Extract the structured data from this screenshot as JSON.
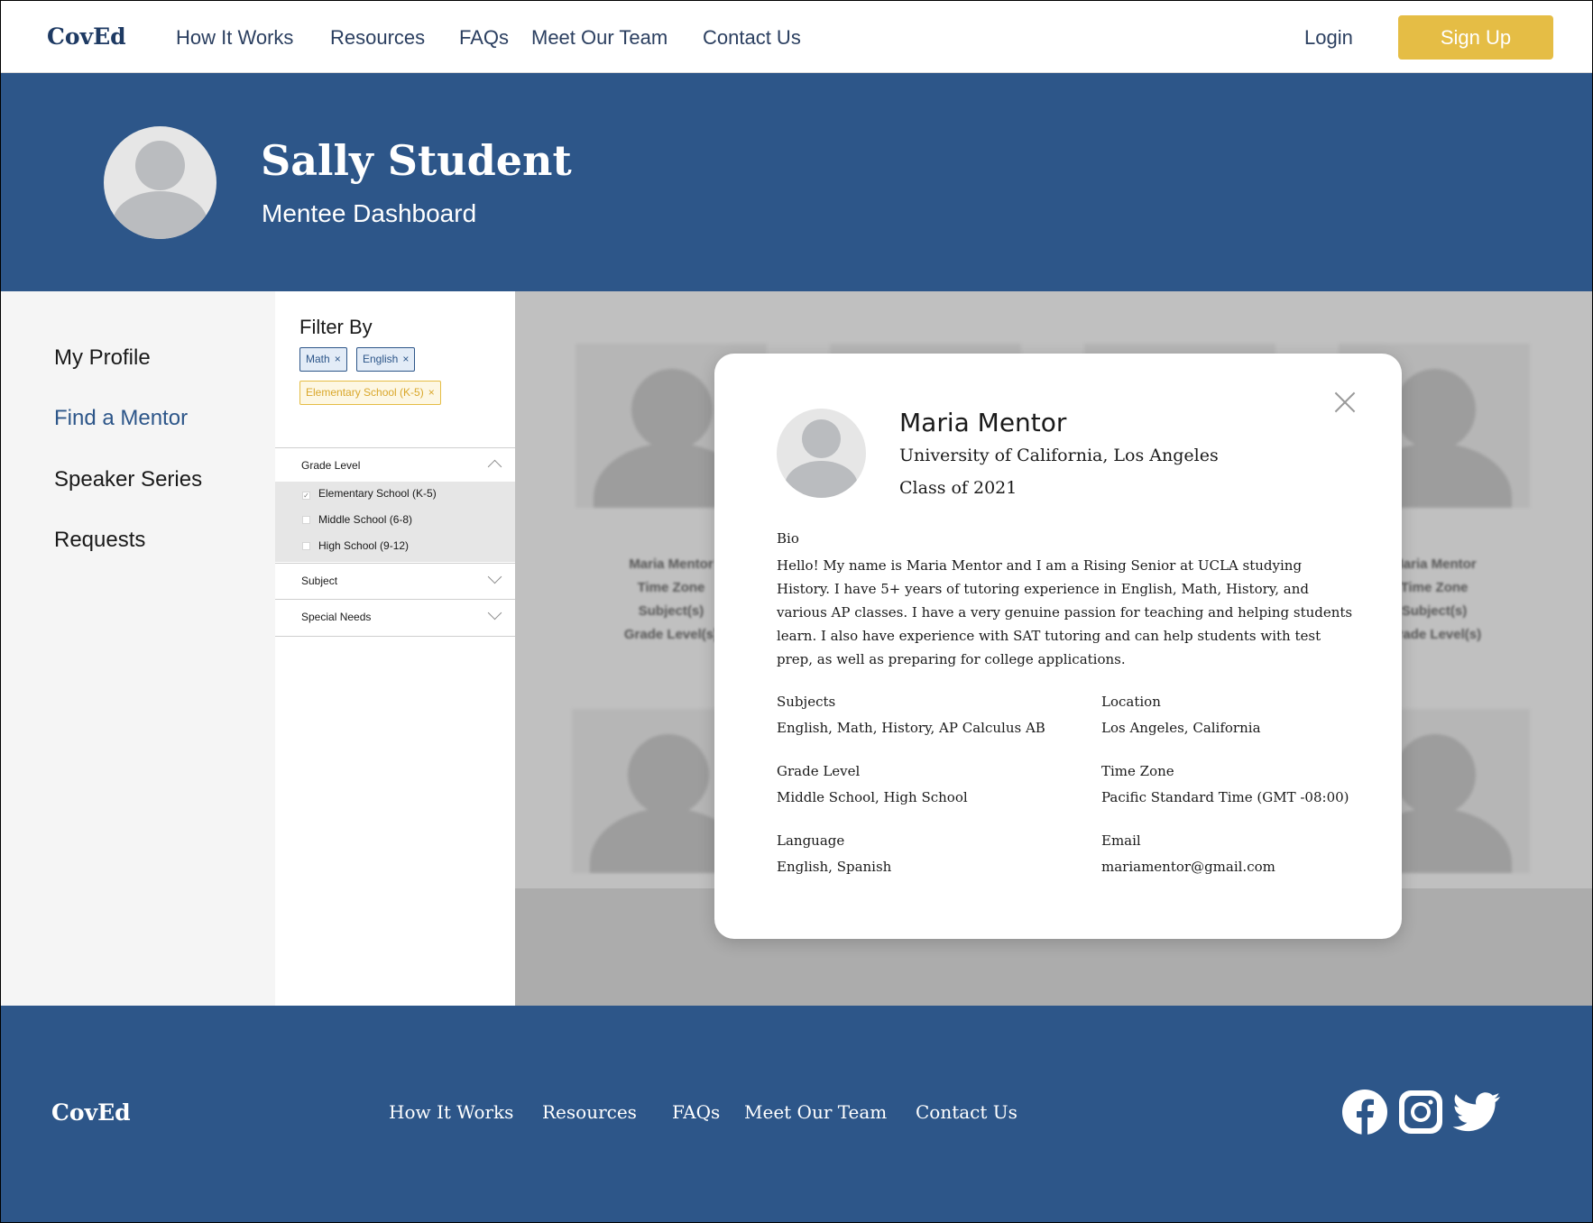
{
  "nav": {
    "logo": "CovEd",
    "links": [
      "How It Works",
      "Resources",
      "FAQs",
      "Meet Our Team",
      "Contact Us"
    ],
    "login": "Login",
    "signup": "Sign Up"
  },
  "hero": {
    "name": "Sally Student",
    "subtitle": "Mentee Dashboard"
  },
  "sidebar": {
    "items": [
      {
        "label": "My Profile"
      },
      {
        "label": "Find a Mentor",
        "active": true
      },
      {
        "label": "Speaker Series"
      },
      {
        "label": "Requests"
      }
    ]
  },
  "filter": {
    "title": "Filter By",
    "chips": [
      "Math",
      "English",
      "Elementary School (K-5)"
    ],
    "chip_close": "×",
    "sections": [
      {
        "label": "Grade Level",
        "expanded": true
      },
      {
        "label": "Subject",
        "expanded": false
      },
      {
        "label": "Special Needs",
        "expanded": false
      }
    ],
    "grade_options": [
      {
        "label": "Elementary School (K-5)",
        "checked": true
      },
      {
        "label": "Middle School (6-8)",
        "checked": false
      },
      {
        "label": "High School (9-12)",
        "checked": false
      }
    ]
  },
  "cards": {
    "left": [
      "Maria Mentor",
      "Time Zone",
      "Subject(s)",
      "Grade Level(s)"
    ],
    "right": [
      "Maria Mentor",
      "Time Zone",
      "Subject(s)",
      "Grade Level(s)"
    ]
  },
  "modal": {
    "name": "Maria Mentor",
    "university": "University of California, Los Angeles",
    "class_year": "Class of 2021",
    "bio_label": "Bio",
    "bio": "Hello! My name is Maria Mentor and I am a Rising Senior at UCLA studying History. I have 5+ years of tutoring experience in English, Math, History, and various AP classes. I have a very genuine passion for teaching and helping students learn. I also have experience with SAT tutoring and can help students with test prep, as well as preparing for college applications.",
    "fields": {
      "subjects": {
        "label": "Subjects",
        "value": "English, Math, History, AP Calculus AB"
      },
      "location": {
        "label": "Location",
        "value": "Los Angeles, California"
      },
      "grade_level": {
        "label": "Grade Level",
        "value": "Middle School, High School"
      },
      "time_zone": {
        "label": "Time Zone",
        "value": "Pacific Standard Time (GMT -08:00)"
      },
      "language": {
        "label": "Language",
        "value": "English, Spanish"
      },
      "email": {
        "label": "Email",
        "value": "mariamentor@gmail.com"
      }
    }
  },
  "footer": {
    "logo": "CovEd",
    "links": [
      "How It Works",
      "Resources",
      "FAQs",
      "Meet Our Team",
      "Contact Us"
    ],
    "social": [
      "facebook-icon",
      "instagram-icon",
      "twitter-icon"
    ]
  },
  "colors": {
    "primary": "#2d5689",
    "accent": "#e5bd45",
    "sidebar_bg": "#f5f5f5"
  }
}
